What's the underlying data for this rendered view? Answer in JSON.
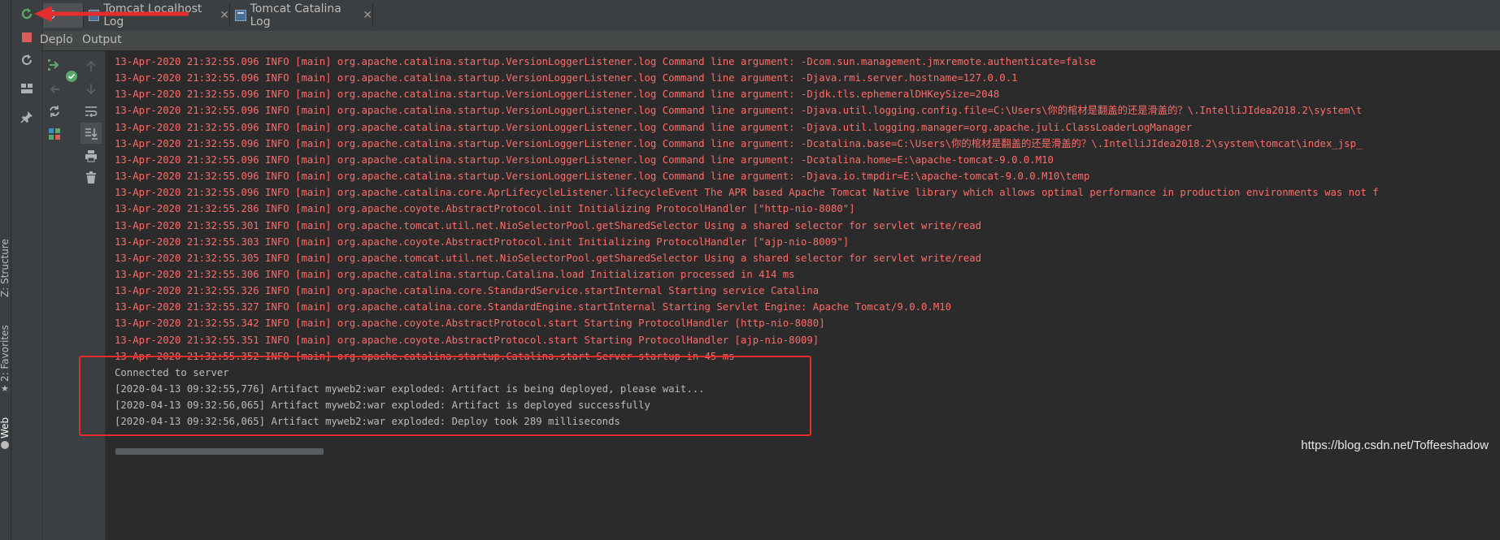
{
  "left_strip": {
    "labels": [
      "Z: Structure",
      "2: Favorites",
      "Web"
    ]
  },
  "tabs": [
    {
      "label": "S"
    },
    {
      "label": "Tomcat Localhost Log",
      "close": "✕"
    },
    {
      "label": "Tomcat Catalina Log",
      "close": "✕"
    }
  ],
  "subheader": {
    "deploy_label": "Deplo",
    "output_label": "Output"
  },
  "icons": {
    "rerun": "rerun-icon",
    "stop": "stop-icon",
    "restart": "restart-icon",
    "layout": "layout-icon",
    "pin": "pin-icon",
    "deploy": "deploy-icon",
    "success": "check-icon",
    "up": "arrow-up-icon",
    "down": "arrow-down-icon",
    "wrap": "soft-wrap-icon",
    "scroll_end": "scroll-to-end-icon",
    "print": "print-icon",
    "trash": "trash-icon",
    "update": "refresh-icon",
    "artifact": "artifact-icon",
    "star": "star-icon"
  },
  "colors": {
    "log_red": "#ff6b68",
    "log_normal": "#bbbbbb",
    "highlight": "#e52d2d",
    "success_green": "#59a869"
  },
  "log_lines": [
    {
      "text": "13-Apr-2020 21:32:55.096 INFO [main] org.apache.catalina.startup.VersionLoggerListener.log Command line argument: -Dcom.sun.management.jmxremote.authenticate=false",
      "style": "red"
    },
    {
      "text": "13-Apr-2020 21:32:55.096 INFO [main] org.apache.catalina.startup.VersionLoggerListener.log Command line argument: -Djava.rmi.server.hostname=127.0.0.1",
      "style": "red"
    },
    {
      "text": "13-Apr-2020 21:32:55.096 INFO [main] org.apache.catalina.startup.VersionLoggerListener.log Command line argument: -Djdk.tls.ephemeralDHKeySize=2048",
      "style": "red"
    },
    {
      "text": "13-Apr-2020 21:32:55.096 INFO [main] org.apache.catalina.startup.VersionLoggerListener.log Command line argument: -Djava.util.logging.config.file=C:\\Users\\你的棺材是翻盖的还是滑盖的？\\.IntelliJIdea2018.2\\system\\t",
      "style": "red"
    },
    {
      "text": "13-Apr-2020 21:32:55.096 INFO [main] org.apache.catalina.startup.VersionLoggerListener.log Command line argument: -Djava.util.logging.manager=org.apache.juli.ClassLoaderLogManager",
      "style": "red"
    },
    {
      "text": "13-Apr-2020 21:32:55.096 INFO [main] org.apache.catalina.startup.VersionLoggerListener.log Command line argument: -Dcatalina.base=C:\\Users\\你的棺材是翻盖的还是滑盖的？\\.IntelliJIdea2018.2\\system\\tomcat\\index_jsp_",
      "style": "red"
    },
    {
      "text": "13-Apr-2020 21:32:55.096 INFO [main] org.apache.catalina.startup.VersionLoggerListener.log Command line argument: -Dcatalina.home=E:\\apache-tomcat-9.0.0.M10",
      "style": "red"
    },
    {
      "text": "13-Apr-2020 21:32:55.096 INFO [main] org.apache.catalina.startup.VersionLoggerListener.log Command line argument: -Djava.io.tmpdir=E:\\apache-tomcat-9.0.0.M10\\temp",
      "style": "red"
    },
    {
      "text": "13-Apr-2020 21:32:55.096 INFO [main] org.apache.catalina.core.AprLifecycleListener.lifecycleEvent The APR based Apache Tomcat Native library which allows optimal performance in production environments was not f",
      "style": "red"
    },
    {
      "text": "13-Apr-2020 21:32:55.286 INFO [main] org.apache.coyote.AbstractProtocol.init Initializing ProtocolHandler [\"http-nio-8080\"]",
      "style": "red"
    },
    {
      "text": "13-Apr-2020 21:32:55.301 INFO [main] org.apache.tomcat.util.net.NioSelectorPool.getSharedSelector Using a shared selector for servlet write/read",
      "style": "red"
    },
    {
      "text": "13-Apr-2020 21:32:55.303 INFO [main] org.apache.coyote.AbstractProtocol.init Initializing ProtocolHandler [\"ajp-nio-8009\"]",
      "style": "red"
    },
    {
      "text": "13-Apr-2020 21:32:55.305 INFO [main] org.apache.tomcat.util.net.NioSelectorPool.getSharedSelector Using a shared selector for servlet write/read",
      "style": "red"
    },
    {
      "text": "13-Apr-2020 21:32:55.306 INFO [main] org.apache.catalina.startup.Catalina.load Initialization processed in 414 ms",
      "style": "red"
    },
    {
      "text": "13-Apr-2020 21:32:55.326 INFO [main] org.apache.catalina.core.StandardService.startInternal Starting service Catalina",
      "style": "red"
    },
    {
      "text": "13-Apr-2020 21:32:55.327 INFO [main] org.apache.catalina.core.StandardEngine.startInternal Starting Servlet Engine: Apache Tomcat/9.0.0.M10",
      "style": "red"
    },
    {
      "text": "13-Apr-2020 21:32:55.342 INFO [main] org.apache.coyote.AbstractProtocol.start Starting ProtocolHandler [http-nio-8080]",
      "style": "red"
    },
    {
      "text": "13-Apr-2020 21:32:55.351 INFO [main] org.apache.coyote.AbstractProtocol.start Starting ProtocolHandler [ajp-nio-8009]",
      "style": "red"
    },
    {
      "text": "13-Apr-2020 21:32:55.352 INFO [main] org.apache.catalina.startup.Catalina.start Server startup in 45 ms",
      "style": "red"
    },
    {
      "text": "Connected to server",
      "style": "norm"
    },
    {
      "text": "[2020-04-13 09:32:55,776] Artifact myweb2:war exploded: Artifact is being deployed, please wait...",
      "style": "norm"
    },
    {
      "text": "[2020-04-13 09:32:56,065] Artifact myweb2:war exploded: Artifact is deployed successfully",
      "style": "norm"
    },
    {
      "text": "[2020-04-13 09:32:56,065] Artifact myweb2:war exploded: Deploy took 289 milliseconds",
      "style": "norm"
    }
  ],
  "watermark": "https://blog.csdn.net/Toffeeshadow"
}
